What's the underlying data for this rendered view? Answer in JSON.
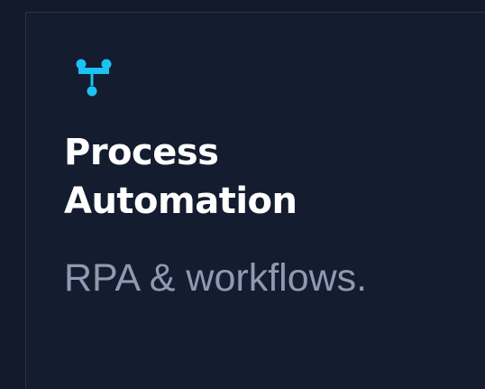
{
  "card": {
    "icon": "workflow-icon",
    "title_line1": "Process",
    "title_line2": "Automation",
    "subtitle": "RPA & workflows."
  },
  "colors": {
    "background": "#121a2b",
    "card_background": "#141c2f",
    "card_border": "#2a3347",
    "accent": "#1cc2f4",
    "title": "#ffffff",
    "subtitle": "#8e9ab3"
  }
}
